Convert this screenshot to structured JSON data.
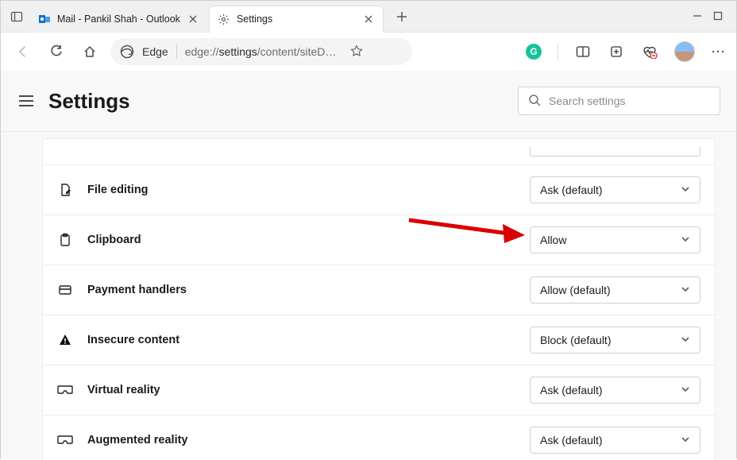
{
  "tabs": [
    {
      "title": "Mail - Pankil Shah - Outlook",
      "active": false
    },
    {
      "title": "Settings",
      "active": true
    }
  ],
  "addressbar": {
    "edge_label": "Edge",
    "url_prefix": "edge://",
    "url_mid": "settings",
    "url_suffix": "/content/siteD…"
  },
  "header": {
    "title": "Settings",
    "search_placeholder": "Search settings"
  },
  "permissions": [
    {
      "icon": "document-edit-icon",
      "label": "File editing",
      "value": "Ask (default)"
    },
    {
      "icon": "clipboard-icon",
      "label": "Clipboard",
      "value": "Allow"
    },
    {
      "icon": "credit-card-icon",
      "label": "Payment handlers",
      "value": "Allow (default)"
    },
    {
      "icon": "warning-icon",
      "label": "Insecure content",
      "value": "Block (default)"
    },
    {
      "icon": "vr-headset-icon",
      "label": "Virtual reality",
      "value": "Ask (default)"
    },
    {
      "icon": "vr-headset-icon",
      "label": "Augmented reality",
      "value": "Ask (default)"
    }
  ]
}
